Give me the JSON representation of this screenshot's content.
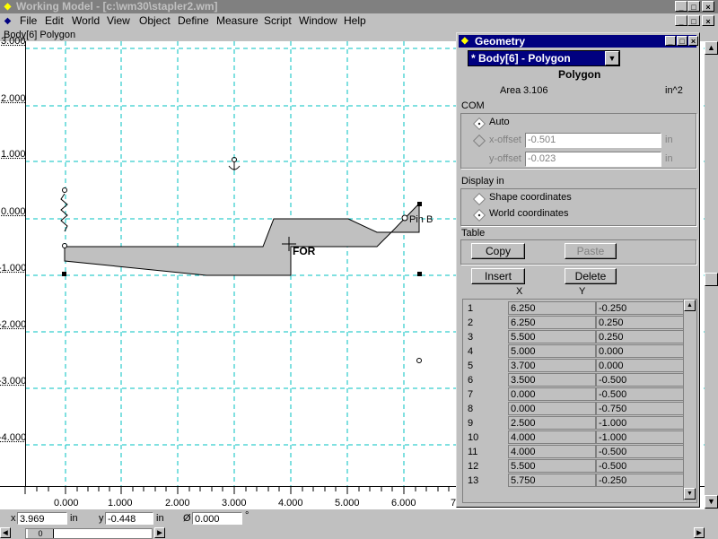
{
  "app": {
    "title": "Working Model - [c:\\wm30\\stapler2.wm]"
  },
  "menu": [
    "File",
    "Edit",
    "World",
    "View",
    "Object",
    "Define",
    "Measure",
    "Script",
    "Window",
    "Help"
  ],
  "doc_title": "Body[6]  Polygon",
  "ruler": {
    "y_labels": [
      "3.000",
      "2.000",
      "1.000",
      "0.000",
      "-1.000",
      "-2.000",
      "-3.000",
      "-4.000"
    ],
    "x_labels": [
      "0.000",
      "1.000",
      "2.000",
      "3.000",
      "4.000",
      "5.000",
      "6.000",
      "7"
    ]
  },
  "canvas": {
    "origin_label": "FOR",
    "pin_label": "Pin B"
  },
  "coords": {
    "x_label": "x",
    "x_value": "3.969",
    "x_unit": "in",
    "y_label": "y",
    "y_value": "-0.448",
    "y_unit": "in",
    "rot_label": "Ø",
    "rot_value": "0.000",
    "rot_unit": "°",
    "zoom_value": "0"
  },
  "geometry": {
    "title": "Geometry",
    "body_select": "* Body[6] - Polygon",
    "shape_type": "Polygon",
    "area_label": "Area",
    "area_value": "3.106",
    "area_unit": "in^2",
    "com_label": "COM",
    "auto_label": "Auto",
    "xoffset_label": "x-offset",
    "xoffset_value": "-0.501",
    "xoffset_unit": "in",
    "yoffset_label": "y-offset",
    "yoffset_value": "-0.023",
    "yoffset_unit": "in",
    "display_label": "Display  in",
    "shape_coords_label": "Shape coordinates",
    "world_coords_label": "World coordinates",
    "table_label": "Table",
    "copy_label": "Copy",
    "paste_label": "Paste",
    "insert_label": "Insert",
    "delete_label": "Delete",
    "col_x": "X",
    "col_y": "Y",
    "rows": [
      {
        "i": "1",
        "x": "6.250",
        "y": "-0.250"
      },
      {
        "i": "2",
        "x": "6.250",
        "y": "0.250"
      },
      {
        "i": "3",
        "x": "5.500",
        "y": "0.250"
      },
      {
        "i": "4",
        "x": "5.000",
        "y": "0.000"
      },
      {
        "i": "5",
        "x": "3.700",
        "y": "0.000"
      },
      {
        "i": "6",
        "x": "3.500",
        "y": "-0.500"
      },
      {
        "i": "7",
        "x": "0.000",
        "y": "-0.500"
      },
      {
        "i": "8",
        "x": "0.000",
        "y": "-0.750"
      },
      {
        "i": "9",
        "x": "2.500",
        "y": "-1.000"
      },
      {
        "i": "10",
        "x": "4.000",
        "y": "-1.000"
      },
      {
        "i": "11",
        "x": "4.000",
        "y": "-0.500"
      },
      {
        "i": "12",
        "x": "5.500",
        "y": "-0.500"
      },
      {
        "i": "13",
        "x": "5.750",
        "y": "-0.250"
      }
    ]
  },
  "colors": {
    "grid": "#00c0c0",
    "polygon_fill": "#c0c0c0",
    "titlebar_active": "#000080",
    "titlebar_inactive": "#808080"
  }
}
